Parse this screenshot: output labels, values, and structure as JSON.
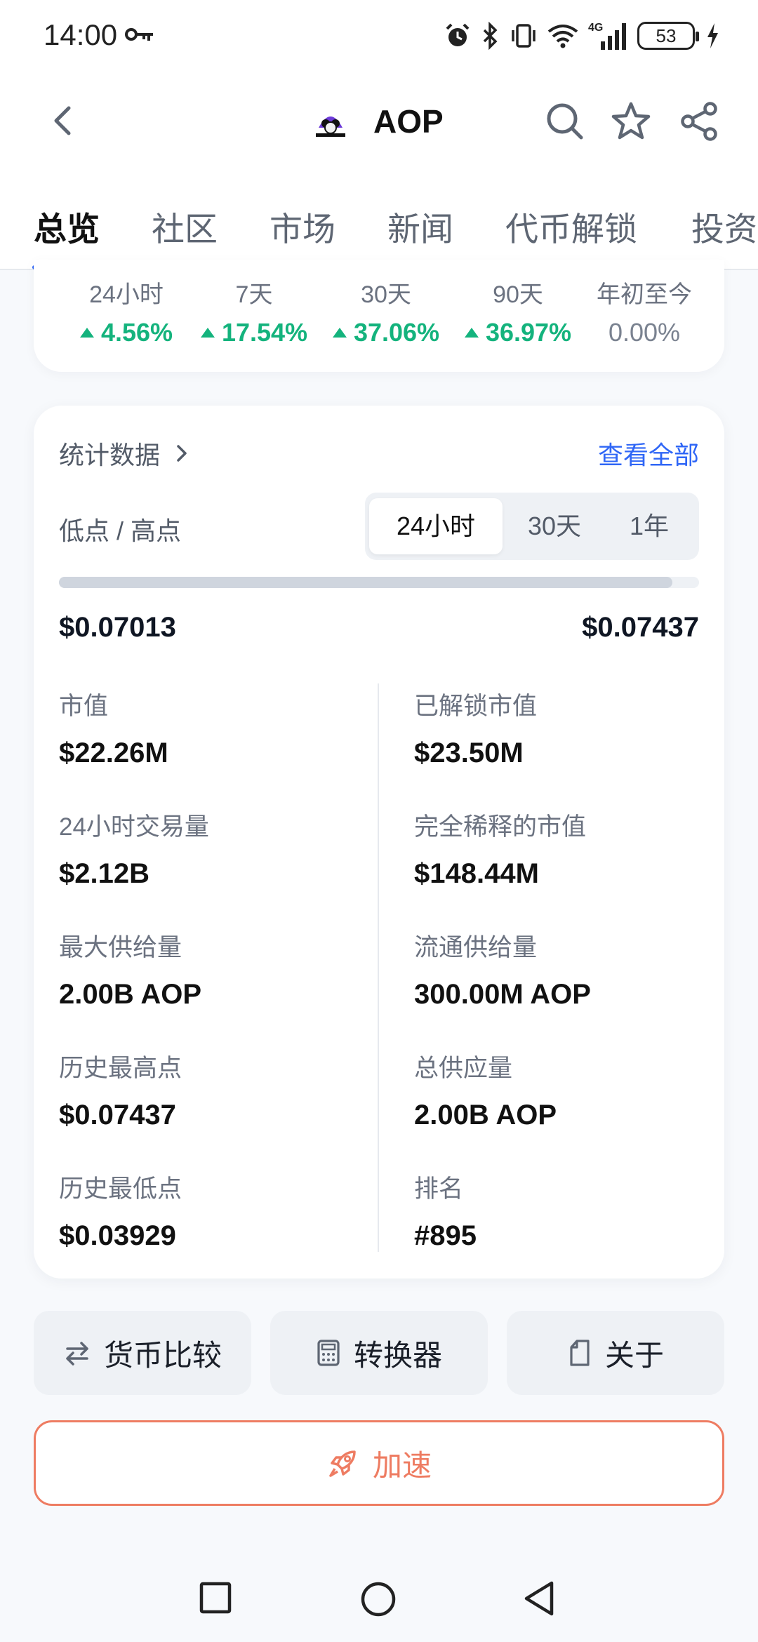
{
  "status_bar": {
    "time": "14:00",
    "battery": "53",
    "network": "4G"
  },
  "header": {
    "coin_name": "AOP"
  },
  "tabs": [
    {
      "label": "总览"
    },
    {
      "label": "社区"
    },
    {
      "label": "市场"
    },
    {
      "label": "新闻"
    },
    {
      "label": "代币解锁"
    },
    {
      "label": "投资"
    }
  ],
  "performance": [
    {
      "label": "24小时",
      "value": "4.56%",
      "trend": "up"
    },
    {
      "label": "7天",
      "value": "17.54%",
      "trend": "up"
    },
    {
      "label": "30天",
      "value": "37.06%",
      "trend": "up"
    },
    {
      "label": "90天",
      "value": "36.97%",
      "trend": "up"
    },
    {
      "label": "年初至今",
      "value": "0.00%",
      "trend": "none"
    }
  ],
  "stats": {
    "title": "统计数据",
    "view_all": "查看全部",
    "low_high_label": "低点 / 高点",
    "periods": [
      "24小时",
      "30天",
      "1年"
    ],
    "selected_period": "24小时",
    "low": "$0.07013",
    "high": "$0.07437",
    "range_fill_fraction": 0.958,
    "items_left": [
      {
        "label": "市值",
        "value": "$22.26M"
      },
      {
        "label": "24小时交易量",
        "value": "$2.12B"
      },
      {
        "label": "最大供给量",
        "value": "2.00B AOP"
      },
      {
        "label": "历史最高点",
        "value": "$0.07437"
      },
      {
        "label": "历史最低点",
        "value": "$0.03929"
      }
    ],
    "items_right": [
      {
        "label": "已解锁市值",
        "value": "$23.50M"
      },
      {
        "label": "完全稀释的市值",
        "value": "$148.44M"
      },
      {
        "label": "流通供给量",
        "value": "300.00M AOP"
      },
      {
        "label": "总供应量",
        "value": "2.00B AOP"
      },
      {
        "label": "排名",
        "value": "#895"
      }
    ]
  },
  "actions": {
    "compare": "货币比较",
    "converter": "转换器",
    "about": "关于",
    "boost": "加速"
  },
  "colors": {
    "accent": "#2f66f6",
    "positive": "#14b37d",
    "boost": "#ee7c62"
  }
}
